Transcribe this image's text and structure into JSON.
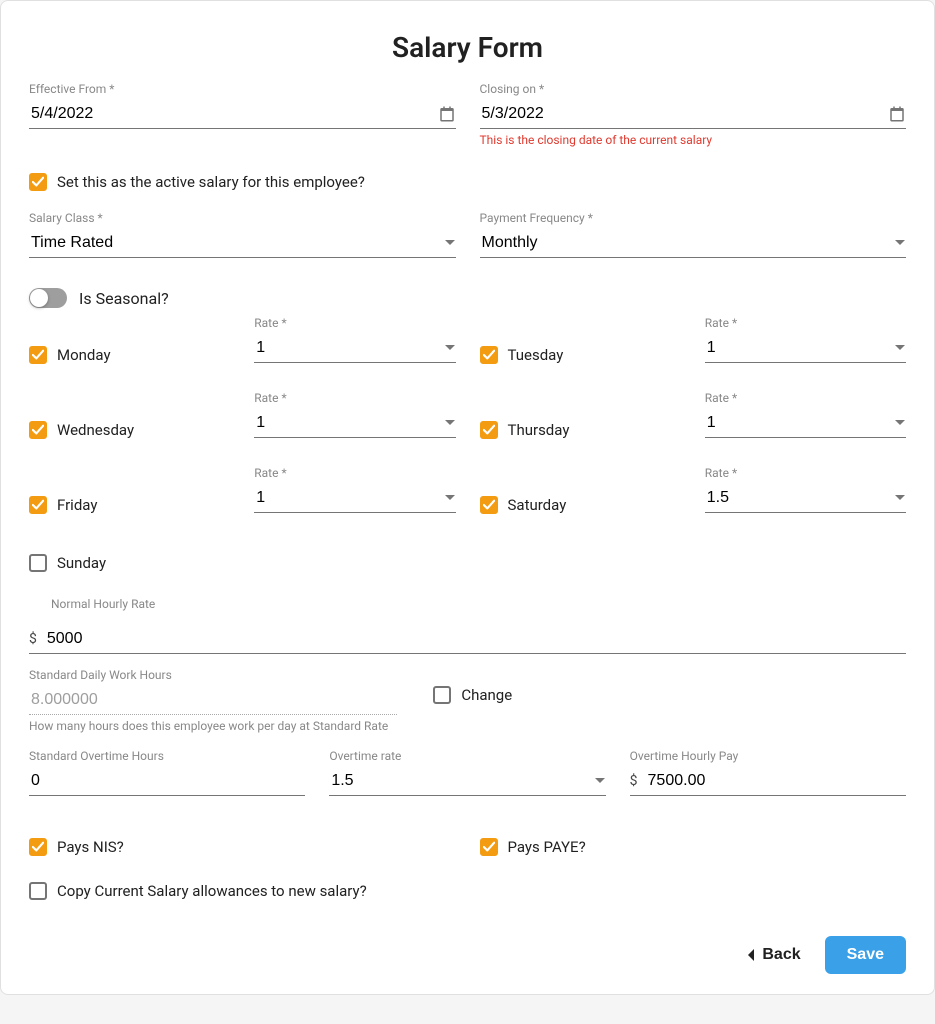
{
  "title": "Salary Form",
  "effective_from": {
    "label": "Effective From *",
    "value": "5/4/2022"
  },
  "closing_on": {
    "label": "Closing on *",
    "value": "5/3/2022",
    "hint": "This is the closing date of the current salary"
  },
  "active_salary": {
    "label": "Set this as the active salary for this employee?",
    "checked": true
  },
  "salary_class": {
    "label": "Salary Class *",
    "value": "Time Rated"
  },
  "payment_freq": {
    "label": "Payment Frequency *",
    "value": "Monthly"
  },
  "seasonal": {
    "label": "Is Seasonal?",
    "on": false
  },
  "rate_label": "Rate *",
  "days": [
    {
      "name": "Monday",
      "checked": true,
      "rate": "1"
    },
    {
      "name": "Tuesday",
      "checked": true,
      "rate": "1"
    },
    {
      "name": "Wednesday",
      "checked": true,
      "rate": "1"
    },
    {
      "name": "Thursday",
      "checked": true,
      "rate": "1"
    },
    {
      "name": "Friday",
      "checked": true,
      "rate": "1"
    },
    {
      "name": "Saturday",
      "checked": true,
      "rate": "1.5"
    },
    {
      "name": "Sunday",
      "checked": false,
      "rate": ""
    }
  ],
  "hourly_rate": {
    "label": "Normal Hourly Rate",
    "prefix": "$",
    "value": "5000"
  },
  "std_hours": {
    "label": "Standard Daily Work Hours",
    "value": "8.000000",
    "hint": "How many hours does this employee work per day at Standard Rate"
  },
  "change": {
    "label": "Change",
    "checked": false
  },
  "std_ot_hours": {
    "label": "Standard Overtime Hours",
    "value": "0"
  },
  "ot_rate": {
    "label": "Overtime rate",
    "value": "1.5"
  },
  "ot_pay": {
    "label": "Overtime Hourly Pay",
    "prefix": "$",
    "value": "7500.00"
  },
  "pays_nis": {
    "label": "Pays NIS?",
    "checked": true
  },
  "pays_paye": {
    "label": "Pays PAYE?",
    "checked": true
  },
  "copy_allow": {
    "label": "Copy Current Salary allowances to new salary?",
    "checked": false
  },
  "buttons": {
    "back": "Back",
    "save": "Save"
  }
}
